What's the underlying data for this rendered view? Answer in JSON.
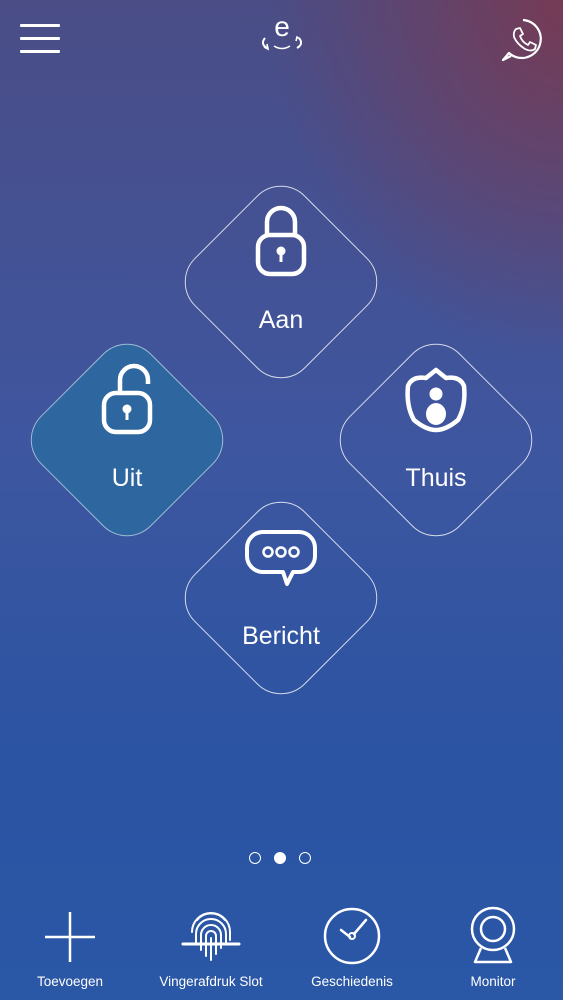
{
  "header": {
    "logo_letter": "e",
    "menu_icon": "hamburger-menu-icon",
    "phone_icon": "phone-chat-icon"
  },
  "modes": [
    {
      "label": "Aan",
      "icon": "lock-closed-icon",
      "active": false
    },
    {
      "label": "Uit",
      "icon": "lock-open-icon",
      "active": true
    },
    {
      "label": "Thuis",
      "icon": "home-person-icon",
      "active": false
    },
    {
      "label": "Bericht",
      "icon": "message-bubble-icon",
      "active": false
    }
  ],
  "pager": {
    "count": 3,
    "current": 2
  },
  "bottom_nav": [
    {
      "label": "Toevoegen",
      "icon": "plus-icon"
    },
    {
      "label": "Vingerafdruk Slot",
      "icon": "fingerprint-icon"
    },
    {
      "label": "Geschiedenis",
      "icon": "clock-icon"
    },
    {
      "label": "Monitor",
      "icon": "webcam-icon"
    }
  ],
  "colors": {
    "active_tile": "#2e679f",
    "background_top": "#4a4d86",
    "background_bottom": "#2a57a6",
    "accent_corner": "#783a52"
  }
}
